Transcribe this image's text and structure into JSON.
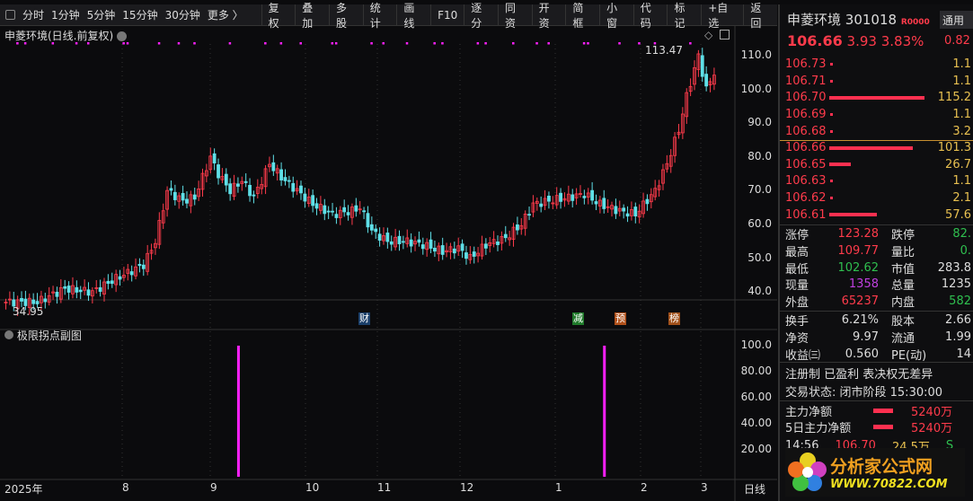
{
  "toolbar": {
    "periods": [
      "分时",
      "1分钟",
      "5分钟",
      "15分钟",
      "30分钟",
      "更多 〉"
    ],
    "buttons": [
      "复权",
      "叠加",
      "多股",
      "统计",
      "画线",
      "F10",
      "逐分",
      "同资",
      "开资",
      "简框",
      "小窗",
      "代码",
      "标记",
      "+自选",
      "返回"
    ]
  },
  "chart": {
    "title": "申菱环境(日线.前复权)",
    "high_label": "113.47",
    "low_label": "34.95",
    "price_ticks": [
      "110.0",
      "100.0",
      "90.0",
      "80.0",
      "70.0",
      "60.0",
      "50.0",
      "40.0"
    ],
    "event_marks": [
      {
        "text": "财",
        "color": "#1a3f6a"
      },
      {
        "text": "减",
        "color": "#1f7a2a"
      },
      {
        "text": "预",
        "color": "#b0501a"
      },
      {
        "text": "榜",
        "color": "#a0501a"
      }
    ],
    "indicator_title": "极限拐点副图",
    "indicator_ticks": [
      "100.0",
      "80.00",
      "60.00",
      "40.00",
      "20.00"
    ],
    "x_labels": [
      "2025年",
      "8",
      "9",
      "10",
      "11",
      "12",
      "1",
      "2",
      "3"
    ],
    "period": "日线",
    "colors": {
      "up": "#ff3b4b",
      "down": "#5fe0e8",
      "signal": "#ff20ff"
    }
  },
  "chart_data": {
    "type": "candlestick",
    "key_closes": [
      [
        0,
        37
      ],
      [
        8,
        37
      ],
      [
        15,
        41
      ],
      [
        22,
        40
      ],
      [
        28,
        44
      ],
      [
        35,
        48
      ],
      [
        38,
        55
      ],
      [
        41,
        70
      ],
      [
        45,
        67
      ],
      [
        48,
        68
      ],
      [
        52,
        80
      ],
      [
        54,
        75
      ],
      [
        57,
        70
      ],
      [
        60,
        73
      ],
      [
        63,
        68
      ],
      [
        67,
        78
      ],
      [
        70,
        74
      ],
      [
        74,
        70
      ],
      [
        78,
        66
      ],
      [
        83,
        63
      ],
      [
        88,
        64
      ],
      [
        90,
        65
      ],
      [
        93,
        58
      ],
      [
        97,
        55
      ],
      [
        102,
        55
      ],
      [
        106,
        54
      ],
      [
        111,
        52
      ],
      [
        115,
        53
      ],
      [
        118,
        50
      ],
      [
        122,
        54
      ],
      [
        127,
        56
      ],
      [
        131,
        60
      ],
      [
        134,
        66
      ],
      [
        138,
        67
      ],
      [
        143,
        68
      ],
      [
        147,
        69
      ],
      [
        151,
        66
      ],
      [
        156,
        64
      ],
      [
        160,
        63
      ],
      [
        165,
        70
      ],
      [
        168,
        78
      ],
      [
        171,
        88
      ],
      [
        173,
        98
      ],
      [
        176,
        110
      ],
      [
        178,
        100
      ],
      [
        180,
        105
      ]
    ],
    "ylim": [
      33,
      115
    ],
    "indicator_signals": [
      59,
      152
    ],
    "indicator_ylim": [
      0,
      105
    ]
  },
  "quote": {
    "name": "申菱环境",
    "code": "301018",
    "tag": "R0000",
    "tab": "通用设",
    "price": "106.66",
    "change": "3.93",
    "pct": "3.83%",
    "side": "0.82",
    "asks": [
      {
        "p": "106.73",
        "v": "1.1",
        "w": 1
      },
      {
        "p": "106.71",
        "v": "1.1",
        "w": 1
      },
      {
        "p": "106.70",
        "v": "115.2",
        "w": 100
      },
      {
        "p": "106.69",
        "v": "1.1",
        "w": 1
      },
      {
        "p": "106.68",
        "v": "3.2",
        "w": 1
      }
    ],
    "bids": [
      {
        "p": "106.66",
        "v": "101.3",
        "w": 88
      },
      {
        "p": "106.65",
        "v": "26.7",
        "w": 23
      },
      {
        "p": "106.63",
        "v": "1.1",
        "w": 1
      },
      {
        "p": "106.62",
        "v": "2.1",
        "w": 1
      },
      {
        "p": "106.61",
        "v": "57.6",
        "w": 50
      }
    ],
    "stats": [
      [
        "涨停",
        "123.28",
        "red",
        "跌停",
        "82.",
        "grn"
      ],
      [
        "最高",
        "109.77",
        "red",
        "量比",
        "0.",
        "grn"
      ],
      [
        "最低",
        "102.62",
        "grn",
        "市值",
        "283.8",
        "wht"
      ],
      [
        "现量",
        "1358",
        "pur",
        "总量",
        "1235",
        "wht"
      ],
      [
        "外盘",
        "65237",
        "red",
        "内盘",
        "582",
        "grn"
      ]
    ],
    "fin": [
      [
        "换手",
        "6.21%",
        "股本",
        "2.66"
      ],
      [
        "净资",
        "9.97",
        "流通",
        "1.99"
      ],
      [
        "收益㈢",
        "0.560",
        "PE(动)",
        "14"
      ]
    ],
    "tags": "注册制 已盈利 表决权无差异",
    "status": "交易状态: 闭市阶段 15:30:00",
    "flows": [
      [
        "主力净额",
        "5240万"
      ],
      [
        "5日主力净额",
        "5240万"
      ]
    ],
    "tick": [
      "14:56",
      "106.70",
      "24.5万",
      "S"
    ]
  },
  "logo": {
    "text": "分析家公式网",
    "url": "WWW.70822.COM"
  }
}
